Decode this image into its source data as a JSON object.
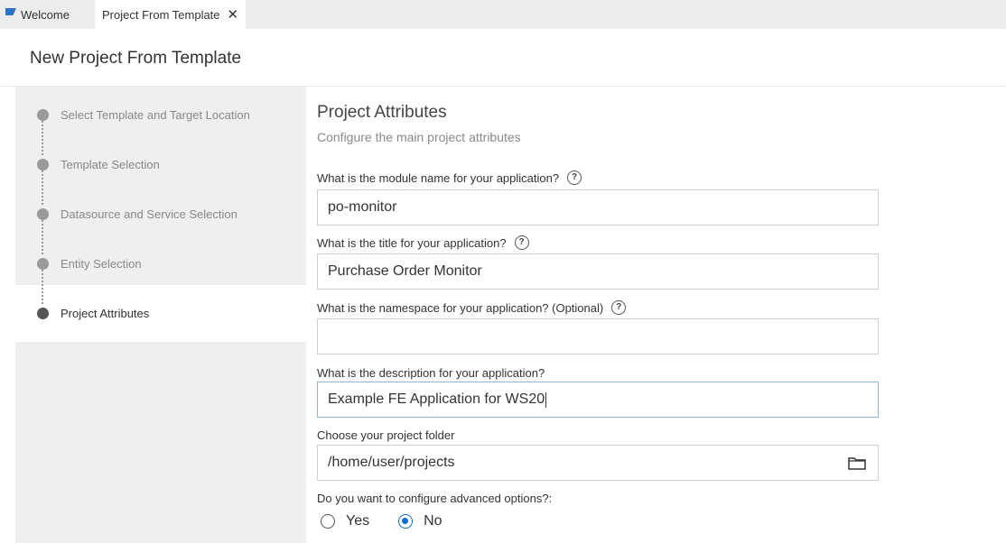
{
  "tabs": [
    {
      "label": "Welcome"
    },
    {
      "label": "Project From Template",
      "close": "✕"
    }
  ],
  "header": {
    "title": "New Project From Template"
  },
  "steps": [
    {
      "label": "Select Template and Target Location"
    },
    {
      "label": "Template Selection"
    },
    {
      "label": "Datasource and Service Selection"
    },
    {
      "label": "Entity Selection"
    },
    {
      "label": "Project Attributes"
    }
  ],
  "form": {
    "title": "Project Attributes",
    "subtitle": "Configure the main project attributes",
    "fields": [
      {
        "label": "What is the module name for your application?",
        "value": "po-monitor",
        "help": "?"
      },
      {
        "label": "What is the title for your application?",
        "value": "Purchase Order Monitor",
        "help": "?"
      },
      {
        "label": "What is the namespace for your application? (Optional)",
        "value": "",
        "help": "?"
      },
      {
        "label": "What is the description for your application?",
        "value": "Example FE Application for WS20"
      },
      {
        "label": "Choose your project folder",
        "value": "/home/user/projects"
      }
    ],
    "advanced": {
      "label": "Do you want to configure advanced options?:",
      "options": [
        "Yes",
        "No"
      ],
      "selected": "No"
    }
  },
  "colors": {
    "accent": "#0a6ed1",
    "stepper_bg": "#efefef"
  },
  "icons": [
    "sap-logo-icon",
    "close-icon",
    "help-icon",
    "folder-icon",
    "radio-icon"
  ]
}
